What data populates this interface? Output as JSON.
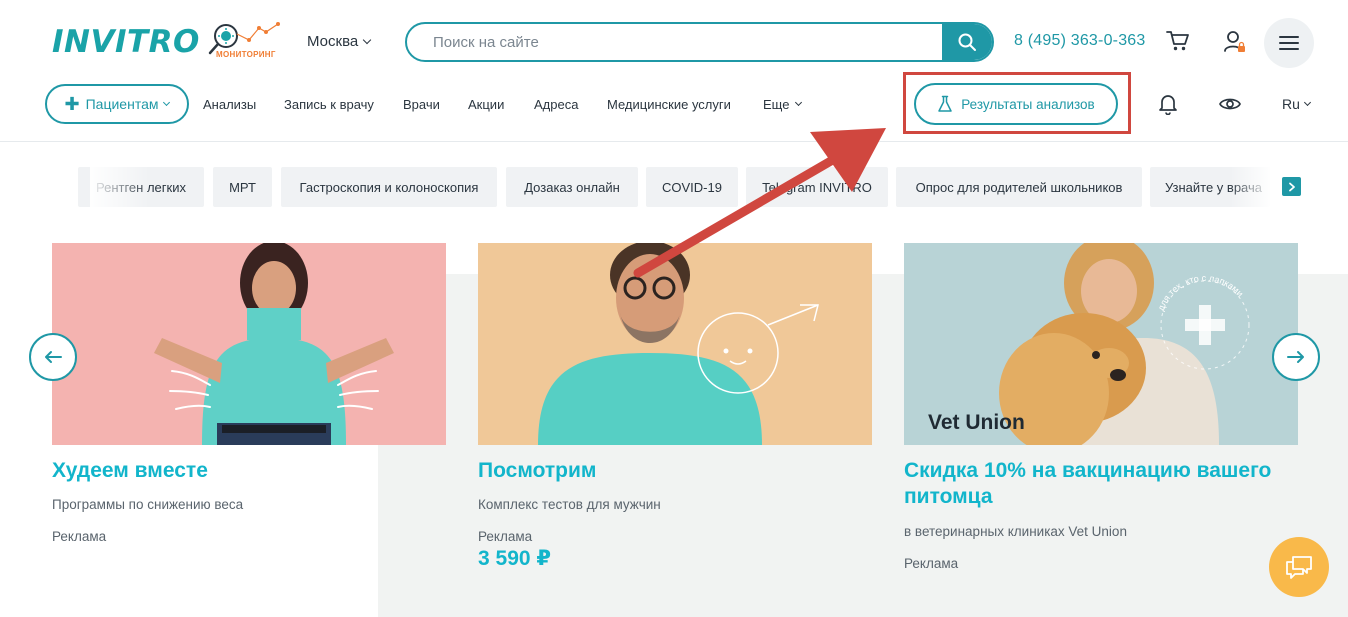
{
  "header": {
    "logo_text": "INVITRO",
    "monitoring_text": "МОНИТОРИНГ",
    "city": "Москва",
    "search_placeholder": "Поиск на сайте",
    "phone": "8 (495) 363-0-363"
  },
  "nav": {
    "patients_label": "Пациентам",
    "links": [
      "Анализы",
      "Запись к врачу",
      "Врачи",
      "Акции",
      "Адреса",
      "Медицинские услуги"
    ],
    "more_label": "Еще",
    "results_label": "Результаты анализов",
    "lang": "Ru"
  },
  "chips": [
    "Рентген легких",
    "МРТ",
    "Гастроскопия и колоноскопия",
    "Дозаказ онлайн",
    "COVID-19",
    "Telegram INVITRO",
    "Опрос для родителей школьников",
    "Узнайте у врача"
  ],
  "cards": [
    {
      "title": "Худеем вместе",
      "subtitle": "Программы по снижению веса",
      "ad": "Реклама",
      "price": ""
    },
    {
      "title": "Посмотрим",
      "subtitle": "Комплекс тестов для мужчин",
      "ad": "Реклама",
      "price": "3 590 ₽"
    },
    {
      "title": "Скидка 10% на вакцинацию вашего питомца",
      "subtitle": "в ветеринарных клиниках Vet Union",
      "ad": "Реклама",
      "price": "",
      "image_text": "Vet Union",
      "badge_text": "для тех, кто с лапками"
    }
  ],
  "colors": {
    "brand_teal": "#1f98a6",
    "title_cyan": "#12b5cb",
    "highlight_red": "#d0473f",
    "chat_orange": "#f9b94a"
  },
  "icons": [
    "search-icon",
    "cart-icon",
    "user-icon",
    "menu-icon",
    "flask-icon",
    "bell-icon",
    "eye-icon",
    "arrow-left-icon",
    "arrow-right-icon",
    "chat-icon"
  ]
}
